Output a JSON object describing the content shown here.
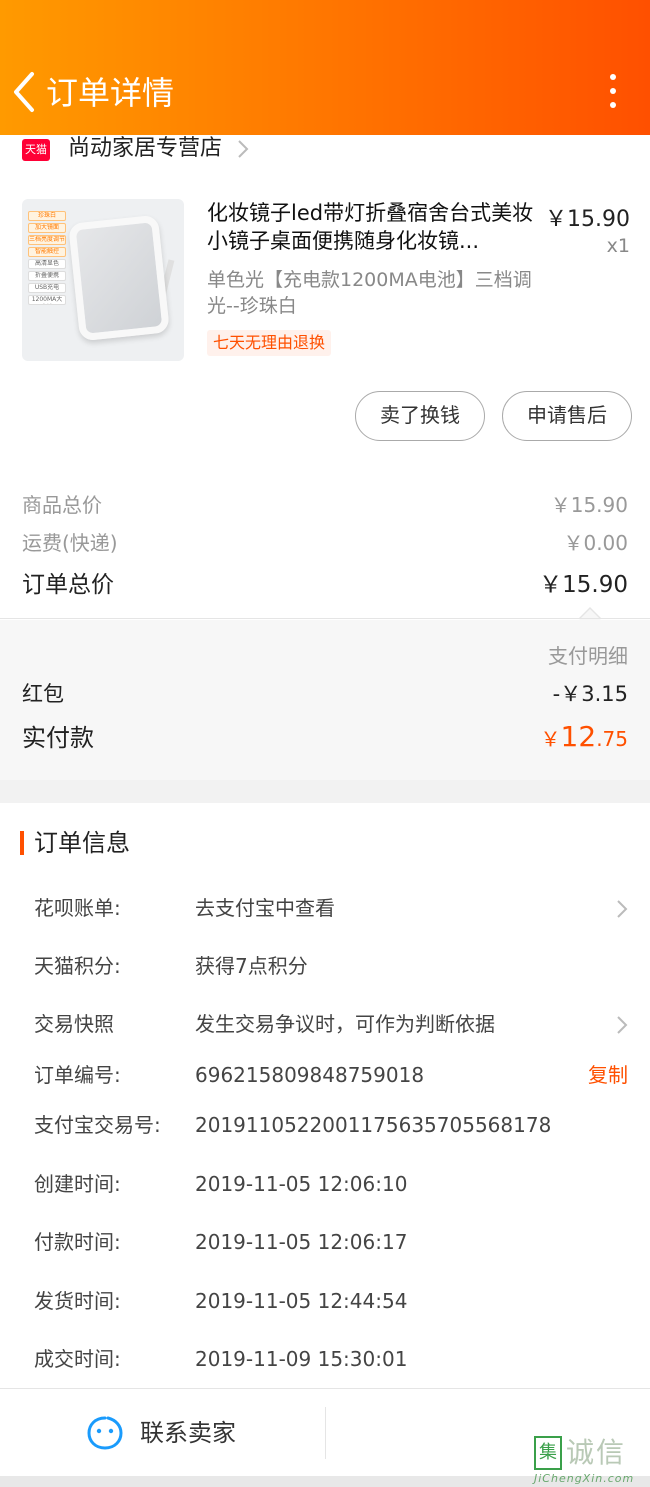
{
  "header": {
    "title": "订单详情"
  },
  "store": {
    "badge": "天猫",
    "name": "尚动家居专营店"
  },
  "product": {
    "title": "化妆镜子led带灯折叠宿舍台式美妆小镜子桌面便携随身化妆镜...",
    "price": "￥15.90",
    "qty": "x1",
    "spec": "单色光【充电款1200MA电池】三档调光--珍珠白",
    "return_badge": "七天无理由退换",
    "image_tags": [
      "珍珠白",
      "加大镜面",
      "三档亮度调节",
      "智能触控",
      "高清显色",
      "折叠便携",
      "USB充电",
      "1200MA大电池"
    ]
  },
  "actions": {
    "sell": "卖了换钱",
    "aftersale": "申请售后"
  },
  "summary": {
    "goods_label": "商品总价",
    "goods_value": "￥15.90",
    "shipping_label": "运费(快递)",
    "shipping_value": "￥0.00",
    "total_label": "订单总价",
    "total_value": "￥15.90"
  },
  "payment": {
    "detail_label": "支付明细",
    "redpacket_label": "红包",
    "redpacket_value": "-￥3.15",
    "paid_label": "实付款",
    "paid_currency": "￥",
    "paid_int": "12",
    "paid_dec": ".75"
  },
  "order_info": {
    "title": "订单信息",
    "rows": [
      {
        "key": "花呗账单:",
        "value": "去支付宝中查看"
      },
      {
        "key": "天猫积分:",
        "value": "获得7点积分"
      },
      {
        "key": "交易快照",
        "value": "发生交易争议时，可作为判断依据"
      },
      {
        "key": "订单编号:",
        "value": "696215809848759018"
      },
      {
        "key": "支付宝交易号:",
        "value": "2019110522001175635705568178"
      },
      {
        "key": "创建时间:",
        "value": "2019-11-05 12:06:10"
      },
      {
        "key": "付款时间:",
        "value": "2019-11-05 12:06:17"
      },
      {
        "key": "发货时间:",
        "value": "2019-11-05 12:44:54"
      },
      {
        "key": "成交时间:",
        "value": "2019-11-09 15:30:01"
      }
    ],
    "copy_label": "复制"
  },
  "bottom": {
    "contact_label": "联系卖家"
  },
  "watermark": {
    "mark": "集",
    "text": "诚信",
    "url": "JiChengXin.com"
  },
  "colors": {
    "accent": "#ff5000",
    "header_start": "#ff9a00",
    "header_end": "#ff5000",
    "tmall_red": "#ff0036"
  }
}
